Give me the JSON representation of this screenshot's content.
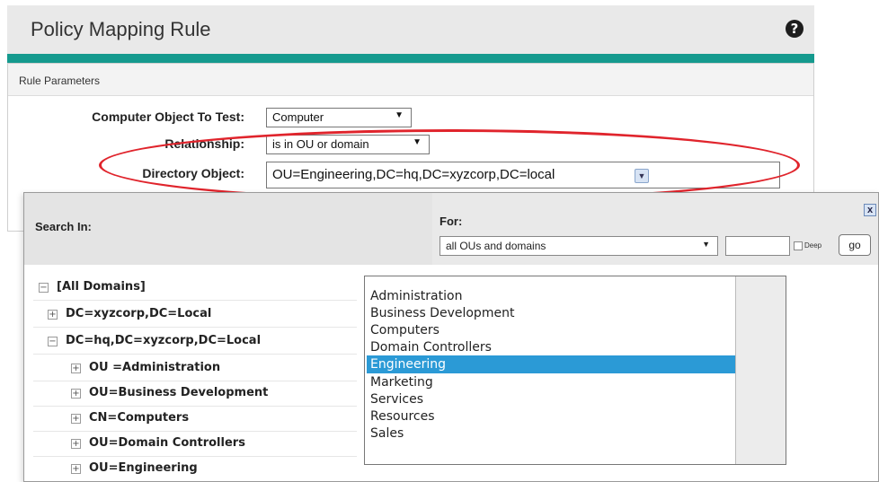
{
  "panel": {
    "title": "Policy Mapping Rule",
    "help_icon": "?",
    "section_title": "Rule Parameters"
  },
  "form": {
    "computer_object_label": "Computer Object To Test:",
    "computer_object_value": "Computer",
    "relationship_label": "Relationship:",
    "relationship_value": "is in OU or domain",
    "directory_object_label": "Directory Object:",
    "directory_object_value": "OU=Engineering,DC=hq,DC=xyzcorp,DC=local"
  },
  "popup": {
    "search_in_label": "Search In:",
    "for_label": "For:",
    "for_value": "all OUs and domains",
    "deep_label": "Deep",
    "go_label": "go",
    "close_label": "x",
    "tree": [
      {
        "label": "[All Domains]",
        "toggle": "−"
      },
      {
        "label": "DC=xyzcorp,DC=Local",
        "toggle": "+"
      },
      {
        "label": "DC=hq,DC=xyzcorp,DC=Local",
        "toggle": "−"
      },
      {
        "label": "OU =Administration",
        "toggle": "+"
      },
      {
        "label": "OU=Business Development",
        "toggle": "+"
      },
      {
        "label": "CN=Computers",
        "toggle": "+"
      },
      {
        "label": "OU=Domain Controllers",
        "toggle": "+"
      },
      {
        "label": "OU=Engineering",
        "toggle": "+"
      }
    ],
    "list": [
      "Administration",
      "Business Development",
      "Computers",
      "Domain Controllers",
      "Engineering",
      "Marketing",
      "Services",
      "Resources",
      "Sales"
    ],
    "selected_item": "Engineering"
  },
  "colors": {
    "accent_teal": "#159a8e",
    "highlight_red": "#e0242c",
    "selection_blue": "#2b9ad6"
  }
}
